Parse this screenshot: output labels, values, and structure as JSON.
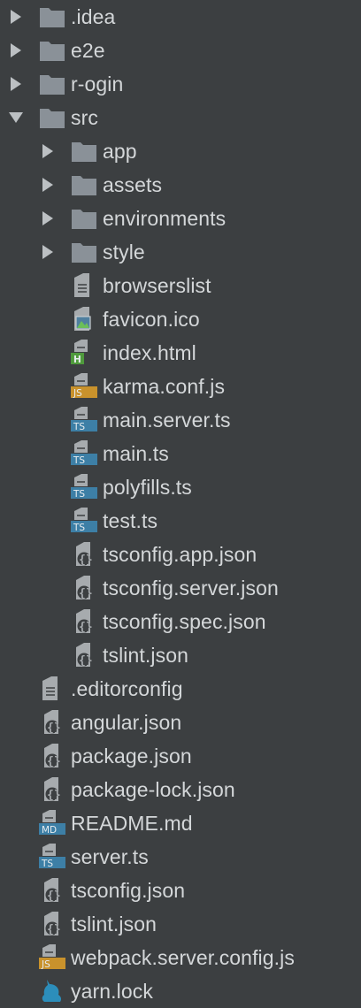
{
  "tree": {
    "items": [
      {
        "label": ".idea",
        "kind": "folder",
        "depth": 0,
        "expanded": false,
        "icon": "folder-icon"
      },
      {
        "label": "e2e",
        "kind": "folder",
        "depth": 0,
        "expanded": false,
        "icon": "folder-icon"
      },
      {
        "label": "r-ogin",
        "kind": "folder",
        "depth": 0,
        "expanded": false,
        "icon": "folder-icon"
      },
      {
        "label": "src",
        "kind": "folder",
        "depth": 0,
        "expanded": true,
        "icon": "folder-icon"
      },
      {
        "label": "app",
        "kind": "folder",
        "depth": 1,
        "expanded": false,
        "icon": "folder-icon"
      },
      {
        "label": "assets",
        "kind": "folder",
        "depth": 1,
        "expanded": false,
        "icon": "folder-icon"
      },
      {
        "label": "environments",
        "kind": "folder",
        "depth": 1,
        "expanded": false,
        "icon": "folder-icon"
      },
      {
        "label": "style",
        "kind": "folder",
        "depth": 1,
        "expanded": false,
        "icon": "folder-icon"
      },
      {
        "label": "browserslist",
        "kind": "file",
        "depth": 1,
        "icon": "text-file-icon"
      },
      {
        "label": "favicon.ico",
        "kind": "file",
        "depth": 1,
        "icon": "image-file-icon"
      },
      {
        "label": "index.html",
        "kind": "file",
        "depth": 1,
        "icon": "html-file-icon",
        "badge": "H"
      },
      {
        "label": "karma.conf.js",
        "kind": "file",
        "depth": 1,
        "icon": "js-file-icon",
        "badge": "JS"
      },
      {
        "label": "main.server.ts",
        "kind": "file",
        "depth": 1,
        "icon": "ts-file-icon",
        "badge": "TS"
      },
      {
        "label": "main.ts",
        "kind": "file",
        "depth": 1,
        "icon": "ts-file-icon",
        "badge": "TS"
      },
      {
        "label": "polyfills.ts",
        "kind": "file",
        "depth": 1,
        "icon": "ts-file-icon",
        "badge": "TS"
      },
      {
        "label": "test.ts",
        "kind": "file",
        "depth": 1,
        "icon": "ts-file-icon",
        "badge": "TS"
      },
      {
        "label": "tsconfig.app.json",
        "kind": "file",
        "depth": 1,
        "icon": "json-file-icon"
      },
      {
        "label": "tsconfig.server.json",
        "kind": "file",
        "depth": 1,
        "icon": "json-file-icon"
      },
      {
        "label": "tsconfig.spec.json",
        "kind": "file",
        "depth": 1,
        "icon": "json-file-icon"
      },
      {
        "label": "tslint.json",
        "kind": "file",
        "depth": 1,
        "icon": "json-file-icon"
      },
      {
        "label": ".editorconfig",
        "kind": "file",
        "depth": 0,
        "icon": "text-file-icon"
      },
      {
        "label": "angular.json",
        "kind": "file",
        "depth": 0,
        "icon": "json-file-icon"
      },
      {
        "label": "package.json",
        "kind": "file",
        "depth": 0,
        "icon": "json-file-icon"
      },
      {
        "label": "package-lock.json",
        "kind": "file",
        "depth": 0,
        "icon": "json-file-icon"
      },
      {
        "label": "README.md",
        "kind": "file",
        "depth": 0,
        "icon": "md-file-icon",
        "badge": "MD"
      },
      {
        "label": "server.ts",
        "kind": "file",
        "depth": 0,
        "icon": "ts-file-icon",
        "badge": "TS"
      },
      {
        "label": "tsconfig.json",
        "kind": "file",
        "depth": 0,
        "icon": "json-file-icon"
      },
      {
        "label": "tslint.json",
        "kind": "file",
        "depth": 0,
        "icon": "json-file-icon"
      },
      {
        "label": "webpack.server.config.js",
        "kind": "file",
        "depth": 0,
        "icon": "js-file-icon",
        "badge": "JS"
      },
      {
        "label": "yarn.lock",
        "kind": "file",
        "depth": 0,
        "icon": "yarn-file-icon"
      }
    ]
  },
  "colors": {
    "background": "#3c3f41",
    "text": "#d4d7d9",
    "arrow": "#bcc0c3",
    "folder": "#8a9198",
    "file_page": "#a7abae",
    "ts_badge": "#3d7fa6",
    "js_badge": "#c9922c",
    "html_badge": "#4f9a3c",
    "md_badge": "#3d7fa6",
    "yarn": "#2c8ebb"
  }
}
